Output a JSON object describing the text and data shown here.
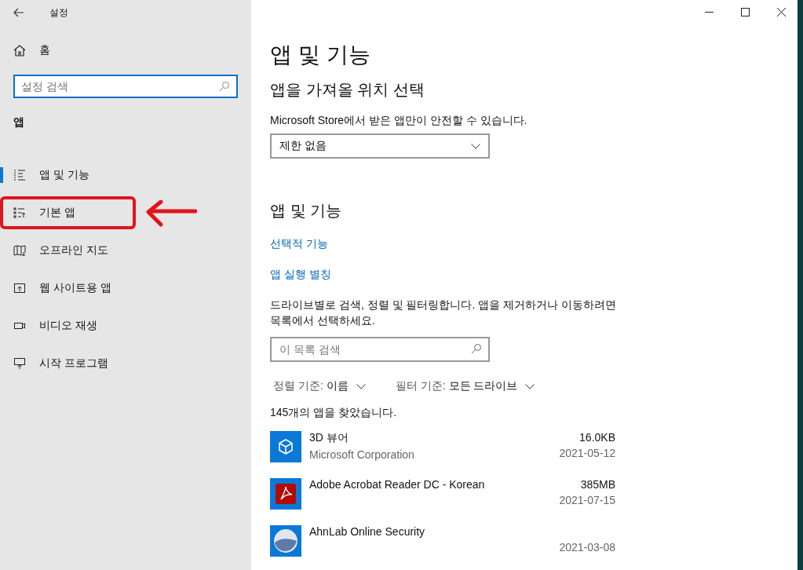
{
  "window": {
    "title": "설정"
  },
  "sidebar": {
    "home": "홈",
    "search": {
      "placeholder": "설정 검색"
    },
    "section": "앱",
    "items": [
      {
        "label": "앱 및 기능",
        "selected": true,
        "annotated": false
      },
      {
        "label": "기본 앱",
        "selected": false,
        "annotated": true
      },
      {
        "label": "오프라인 지도",
        "selected": false,
        "annotated": false
      },
      {
        "label": "웹 사이트용 앱",
        "selected": false,
        "annotated": false
      },
      {
        "label": "비디오 재생",
        "selected": false,
        "annotated": false
      },
      {
        "label": "시작 프로그램",
        "selected": false,
        "annotated": false
      }
    ]
  },
  "main": {
    "title": "앱 및 기능",
    "source_heading": "앱을 가져올 위치 선택",
    "source_note": "Microsoft Store에서 받은 앱만이 안전할 수 있습니다.",
    "source_value": "제한 없음",
    "section_heading": "앱 및 기능",
    "links": [
      "선택적 기능",
      "앱 실행 별칭"
    ],
    "description": "드라이브별로 검색, 정렬 및 필터링합니다. 앱을 제거하거나 이동하려면 목록에서 선택하세요.",
    "list_search": {
      "placeholder": "이 목록 검색"
    },
    "sort": {
      "label": "정렬 기준:",
      "value": "이름"
    },
    "filter": {
      "label": "필터 기준:",
      "value": "모든 드라이브"
    },
    "count": "145개의 앱을 찾았습니다.",
    "apps": [
      {
        "name": "3D 뷰어",
        "publisher": "Microsoft Corporation",
        "size": "16.0KB",
        "date": "2021-05-12"
      },
      {
        "name": "Adobe Acrobat Reader DC - Korean",
        "size": "385MB",
        "date": "2021-07-15"
      },
      {
        "name": "AhnLab Online Security",
        "date": "2021-03-08"
      }
    ]
  }
}
